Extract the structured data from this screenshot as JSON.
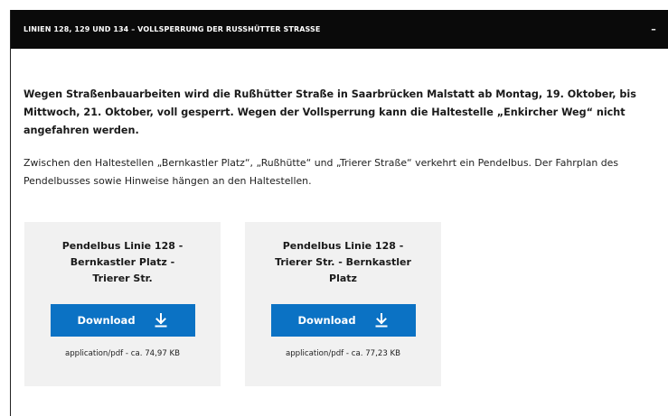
{
  "accordion": {
    "title": "LINIEN 128, 129 UND 134 – VOLLSPERRUNG DER RUSSHÜTTER STRASSE",
    "toggle_symbol": "–"
  },
  "content": {
    "lead": "Wegen Straßenbauarbeiten wird die Rußhütter Straße in Saarbrücken Malstatt ab Montag, 19. Oktober, bis Mittwoch, 21. Oktober, voll gesperrt. Wegen der Vollsperrung kann die Haltestelle „Enkircher Weg“ nicht angefahren werden.",
    "body": "Zwischen den Haltestellen „Bernkastler Platz“, „Rußhütte“ und „Trierer Straße“ verkehrt ein Pendelbus. Der Fahrplan des Pendelbusses sowie Hinweise hängen an den Haltestellen."
  },
  "downloads": [
    {
      "title": "Pendelbus Linie 128 - Bernkastler Platz - Trierer Str.",
      "button_label": "Download",
      "icon": "download-icon",
      "meta": "application/pdf - ca. 74,97 KB"
    },
    {
      "title": "Pendelbus Linie 128 - Trierer Str. - Bernkastler Platz",
      "button_label": "Download",
      "icon": "download-icon",
      "meta": "application/pdf - ca. 77,23 KB"
    }
  ],
  "colors": {
    "header_bg": "#0a0a0a",
    "button_bg": "#0b72c4",
    "card_bg": "#f1f1f1"
  }
}
